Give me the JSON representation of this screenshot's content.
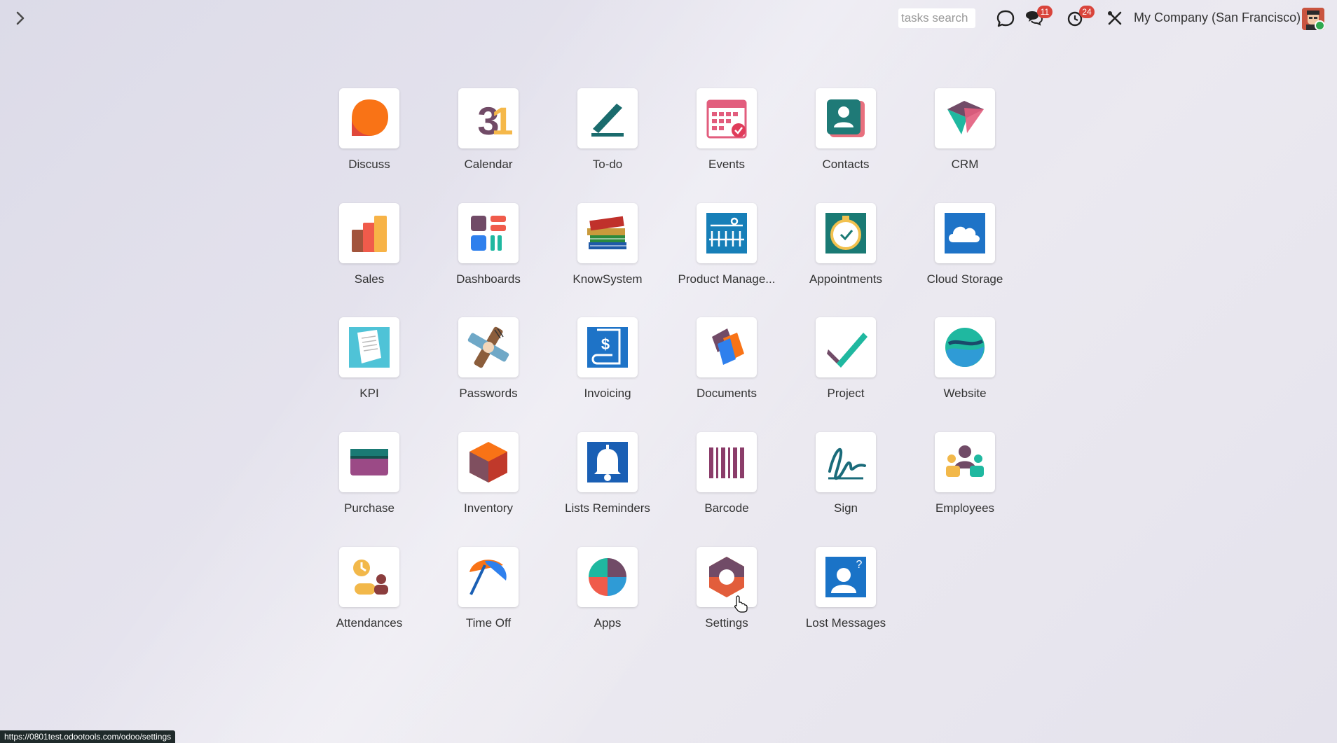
{
  "topbar": {
    "search_placeholder": "tasks search",
    "company": "My Company (San Francisco)",
    "messages_badge": "11",
    "activities_badge": "24"
  },
  "apps": [
    {
      "label": "Discuss",
      "icon": "discuss-icon"
    },
    {
      "label": "Calendar",
      "icon": "calendar-icon"
    },
    {
      "label": "To-do",
      "icon": "todo-icon"
    },
    {
      "label": "Events",
      "icon": "events-icon"
    },
    {
      "label": "Contacts",
      "icon": "contacts-icon"
    },
    {
      "label": "CRM",
      "icon": "crm-icon"
    },
    {
      "label": "Sales",
      "icon": "sales-icon"
    },
    {
      "label": "Dashboards",
      "icon": "dashboards-icon"
    },
    {
      "label": "KnowSystem",
      "icon": "knowsystem-icon"
    },
    {
      "label": "Product Manage...",
      "icon": "product-management-icon"
    },
    {
      "label": "Appointments",
      "icon": "appointments-icon"
    },
    {
      "label": "Cloud Storage",
      "icon": "cloud-storage-icon"
    },
    {
      "label": "KPI",
      "icon": "kpi-icon"
    },
    {
      "label": "Passwords",
      "icon": "passwords-icon"
    },
    {
      "label": "Invoicing",
      "icon": "invoicing-icon"
    },
    {
      "label": "Documents",
      "icon": "documents-icon"
    },
    {
      "label": "Project",
      "icon": "project-icon"
    },
    {
      "label": "Website",
      "icon": "website-icon"
    },
    {
      "label": "Purchase",
      "icon": "purchase-icon"
    },
    {
      "label": "Inventory",
      "icon": "inventory-icon"
    },
    {
      "label": "Lists Reminders",
      "icon": "lists-reminders-icon"
    },
    {
      "label": "Barcode",
      "icon": "barcode-icon"
    },
    {
      "label": "Sign",
      "icon": "sign-icon"
    },
    {
      "label": "Employees",
      "icon": "employees-icon"
    },
    {
      "label": "Attendances",
      "icon": "attendances-icon"
    },
    {
      "label": "Time Off",
      "icon": "time-off-icon"
    },
    {
      "label": "Apps",
      "icon": "apps-icon"
    },
    {
      "label": "Settings",
      "icon": "settings-icon"
    },
    {
      "label": "Lost Messages",
      "icon": "lost-messages-icon"
    }
  ],
  "status_url": "https://0801test.odootools.com/odoo/settings",
  "colors": {
    "badge": "#d9443b",
    "accent": "#714b67"
  }
}
